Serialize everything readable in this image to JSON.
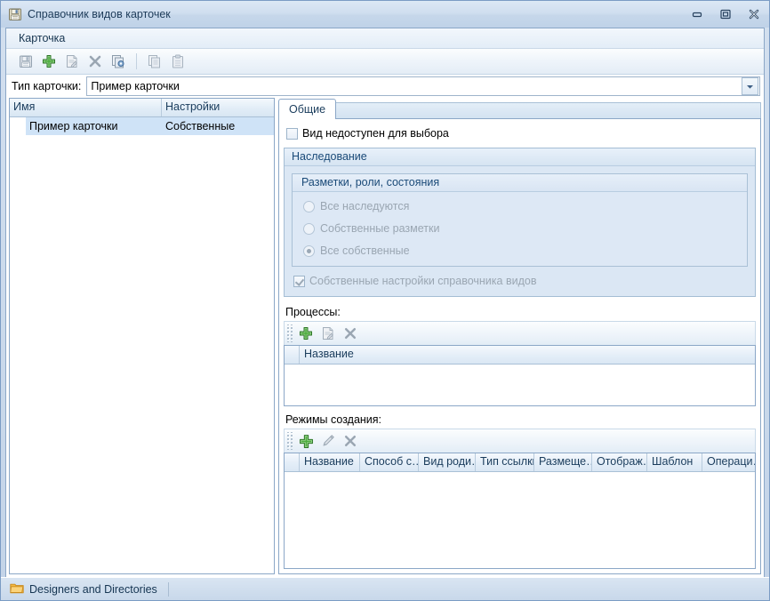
{
  "window": {
    "title": "Справочник видов карточек",
    "icon": "save-floppy-icon",
    "buttons": {
      "minimize": "Свернуть",
      "maximize": "Развернуть",
      "close": "Закрыть"
    }
  },
  "menu": {
    "items": [
      {
        "label": "Карточка"
      }
    ]
  },
  "toolbar": {
    "buttons": [
      {
        "name": "save",
        "icon": "save-icon",
        "enabled": false
      },
      {
        "name": "add",
        "icon": "plus-icon",
        "enabled": true
      },
      {
        "name": "edit",
        "icon": "edit-icon",
        "enabled": false
      },
      {
        "name": "delete",
        "icon": "delete-x-icon",
        "enabled": false
      },
      {
        "name": "refresh",
        "icon": "copy-settings-icon",
        "enabled": true
      },
      {
        "name": "copy",
        "icon": "copy-icon",
        "enabled": false
      },
      {
        "name": "paste",
        "icon": "paste-icon",
        "enabled": false
      }
    ]
  },
  "card_type": {
    "label": "Тип карточки:",
    "value": "Пример карточки",
    "dropdown_icon": "chevron-down-icon"
  },
  "left_grid": {
    "columns": [
      "Имя",
      "Настройки"
    ],
    "rows": [
      {
        "name": "Пример карточки",
        "settings": "Собственные",
        "selected": true
      }
    ]
  },
  "tabs": [
    {
      "label": "Общие",
      "active": true
    }
  ],
  "general": {
    "unavailable_checkbox": {
      "label": "Вид недоступен для выбора",
      "checked": false,
      "enabled": true
    },
    "inheritance": {
      "title": "Наследование",
      "inner": {
        "title": "Разметки, роли, состояния",
        "options": [
          {
            "label": "Все наследуются",
            "selected": false
          },
          {
            "label": "Собственные разметки",
            "selected": false
          },
          {
            "label": "Все собственные",
            "selected": true
          }
        ]
      },
      "own_settings_checkbox": {
        "label": "Собственные настройки справочника видов",
        "checked": true,
        "enabled": false
      }
    },
    "processes": {
      "label": "Процессы:",
      "toolbar": [
        {
          "name": "add",
          "icon": "plus-icon",
          "enabled": true
        },
        {
          "name": "edit",
          "icon": "edit-icon",
          "enabled": false
        },
        {
          "name": "delete",
          "icon": "delete-x-icon",
          "enabled": false
        }
      ],
      "columns": [
        "Название"
      ],
      "rows": []
    },
    "creation_modes": {
      "label": "Режимы создания:",
      "toolbar": [
        {
          "name": "add",
          "icon": "plus-icon",
          "enabled": true
        },
        {
          "name": "edit",
          "icon": "pencil-icon",
          "enabled": false
        },
        {
          "name": "delete",
          "icon": "delete-x-icon",
          "enabled": false
        }
      ],
      "columns": [
        "Название",
        "Способ с…",
        "Вид роди…",
        "Тип ссылки",
        "Размеще…",
        "Отображ…",
        "Шаблон",
        "Операци…"
      ],
      "rows": []
    }
  },
  "statusbar": {
    "items": [
      {
        "label": "Designers and Directories",
        "icon": "folder-icon"
      }
    ]
  },
  "colors": {
    "window_frame": "#7b9cc4",
    "titlebar_start": "#dce8f5",
    "titlebar_end": "#bfd2e8",
    "accent_text": "#1a4a78",
    "selection": "#cfe3f7",
    "green": "#3a9c34",
    "disabled_text": "#9aa6b2",
    "folder": "#f0a830"
  }
}
